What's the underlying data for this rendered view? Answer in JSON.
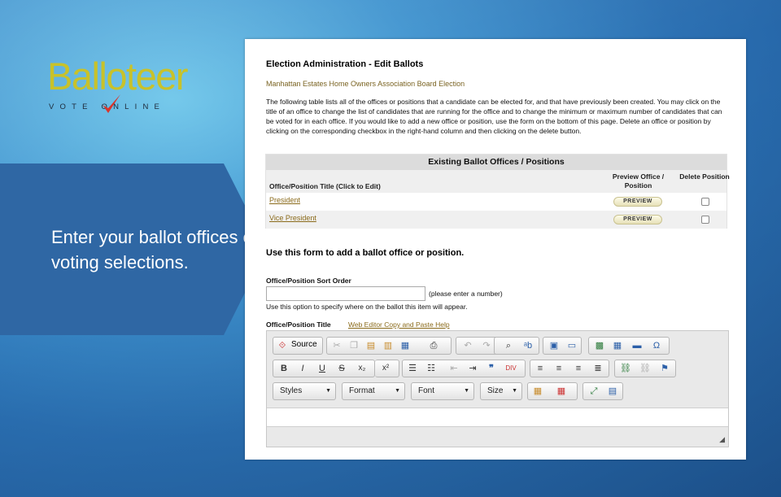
{
  "brand": {
    "name": "Balloteer",
    "tagline": "VOTE   ONLINE",
    "accent": "#c8c22a",
    "check_color": "#d9342b"
  },
  "band": {
    "text": "Enter your ballot offices or voting selections.",
    "color": "#2f67a4"
  },
  "page": {
    "title": "Election Administration - Edit Ballots",
    "subtitle": "Manhattan Estates Home Owners Association Board Election",
    "description": "The following table lists all of the offices or positions that a candidate can be elected for, and that have previously been created. You may click on the title of an office to change the list of candidates that are running for the office and to change the minimum or maximum number of candidates that can be voted for in each office. If you would like to add a new office or position, use the form on the bottom of this page. Delete an office or position by clicking on the corresponding checkbox in the right-hand column and then clicking on the delete button."
  },
  "table": {
    "heading": "Existing Ballot Offices / Positions",
    "col_title": "Office/Position Title (Click to Edit)",
    "col_preview": "Preview Office / Position",
    "col_delete": "Delete Position",
    "rows": [
      {
        "name": "President",
        "preview": "PREVIEW"
      },
      {
        "name": "Vice President",
        "preview": "PREVIEW"
      }
    ]
  },
  "form": {
    "heading": "Use this form to add a ballot office or position.",
    "sort_label": "Office/Position Sort Order",
    "sort_value": "",
    "sort_hint": "(please enter a number)",
    "sort_note": "Use this option to specify where on the ballot this item will appear.",
    "title_label": "Office/Position Title",
    "help_link": "Web Editor Copy and Paste Help"
  },
  "editor": {
    "source_label": "Source",
    "bold": "B",
    "italic": "I",
    "underline": "U",
    "strike": "S",
    "styles": "Styles",
    "format": "Format",
    "font": "Font",
    "size": "Size"
  },
  "icons": [
    "source-icon",
    "cut-icon",
    "copy-icon",
    "paste-icon",
    "paste-text-icon",
    "paste-word-icon",
    "print-icon",
    "undo-icon",
    "redo-icon",
    "find-icon",
    "replace-icon",
    "select-all-icon",
    "image-icon",
    "flash-icon",
    "table-icon",
    "hr-icon",
    "special-char-icon",
    "ordered-list-icon",
    "unordered-list-icon",
    "outdent-icon",
    "indent-icon",
    "blockquote-icon",
    "div-icon",
    "align-left-icon",
    "align-center-icon",
    "align-right-icon",
    "justify-icon",
    "link-icon",
    "unlink-icon",
    "anchor-icon",
    "text-color-icon",
    "bg-color-icon",
    "maximize-icon",
    "show-blocks-icon"
  ]
}
